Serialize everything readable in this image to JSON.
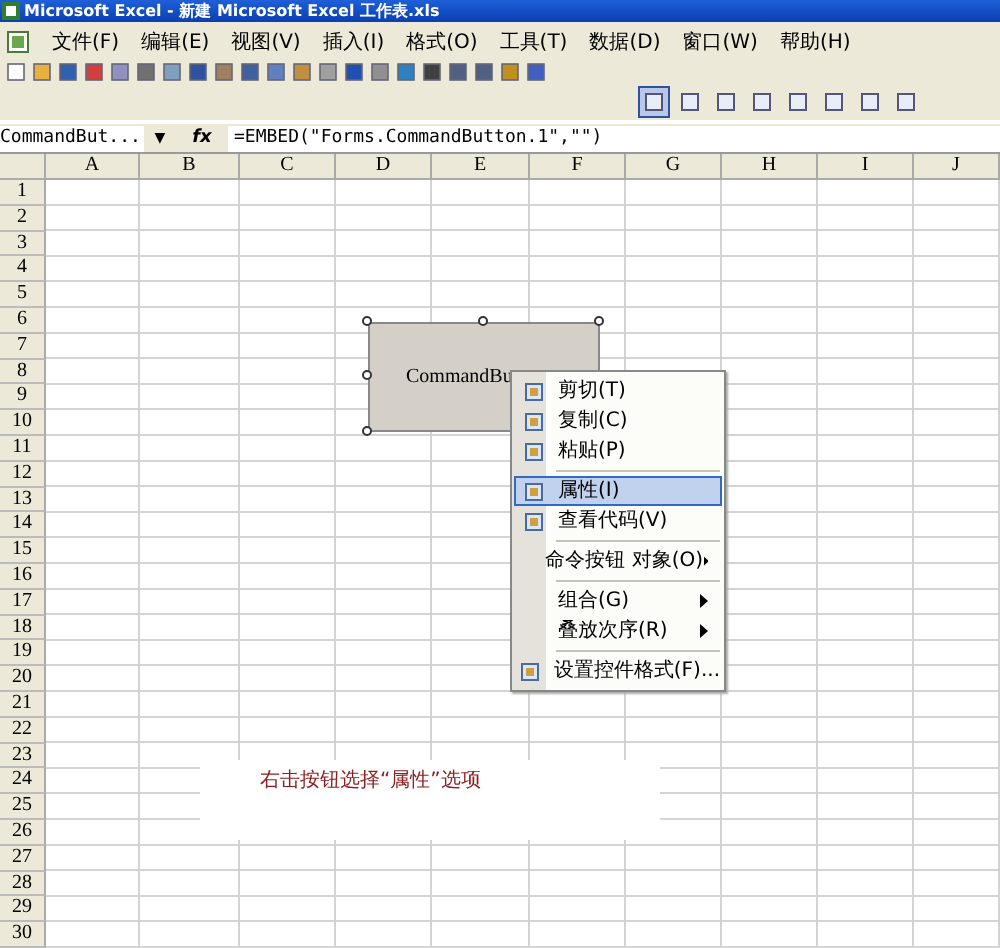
{
  "window": {
    "title": "Microsoft Excel - 新建 Microsoft Excel 工作表.xls"
  },
  "menu_bar": [
    "文件(F)",
    "编辑(E)",
    "视图(V)",
    "插入(I)",
    "格式(O)",
    "工具(T)",
    "数据(D)",
    "窗口(W)",
    "帮助(H)"
  ],
  "toolbar_2": {
    "design_mode": {
      "selected": true
    }
  },
  "formula_bar": {
    "name_box": "CommandBut...",
    "dropdown": "▼",
    "fx": "fx",
    "formula": "=EMBED(\"Forms.CommandButton.1\",\"\")"
  },
  "columns": [
    "A",
    "B",
    "C",
    "D",
    "E",
    "F",
    "G",
    "H",
    "I",
    "J"
  ],
  "rows": [
    "1",
    "2",
    "3",
    "4",
    "5",
    "6",
    "7",
    "8",
    "9",
    "10",
    "11",
    "12",
    "13",
    "14",
    "15",
    "16",
    "17",
    "18",
    "19",
    "20",
    "21",
    "22",
    "23",
    "24",
    "25",
    "26",
    "27",
    "28",
    "29",
    "30"
  ],
  "command_button": {
    "label": "CommandBu"
  },
  "context_menu": [
    {
      "label": "剪切(T)",
      "selected": false,
      "submenu": false,
      "separator_before": false
    },
    {
      "label": "复制(C)",
      "selected": false,
      "submenu": false,
      "separator_before": false
    },
    {
      "label": "粘贴(P)",
      "selected": false,
      "submenu": false,
      "separator_before": false
    },
    {
      "label": "属性(I)",
      "selected": true,
      "submenu": false,
      "separator_before": true
    },
    {
      "label": "查看代码(V)",
      "selected": false,
      "submenu": false,
      "separator_before": false
    },
    {
      "label": "命令按钮 对象(O)",
      "selected": false,
      "submenu": true,
      "separator_before": true
    },
    {
      "label": "组合(G)",
      "selected": false,
      "submenu": true,
      "separator_before": true
    },
    {
      "label": "叠放次序(R)",
      "selected": false,
      "submenu": true,
      "separator_before": false
    },
    {
      "label": "设置控件格式(F)...",
      "selected": false,
      "submenu": false,
      "separator_before": true
    }
  ],
  "annotation": "右击按钮选择“属性”选项"
}
